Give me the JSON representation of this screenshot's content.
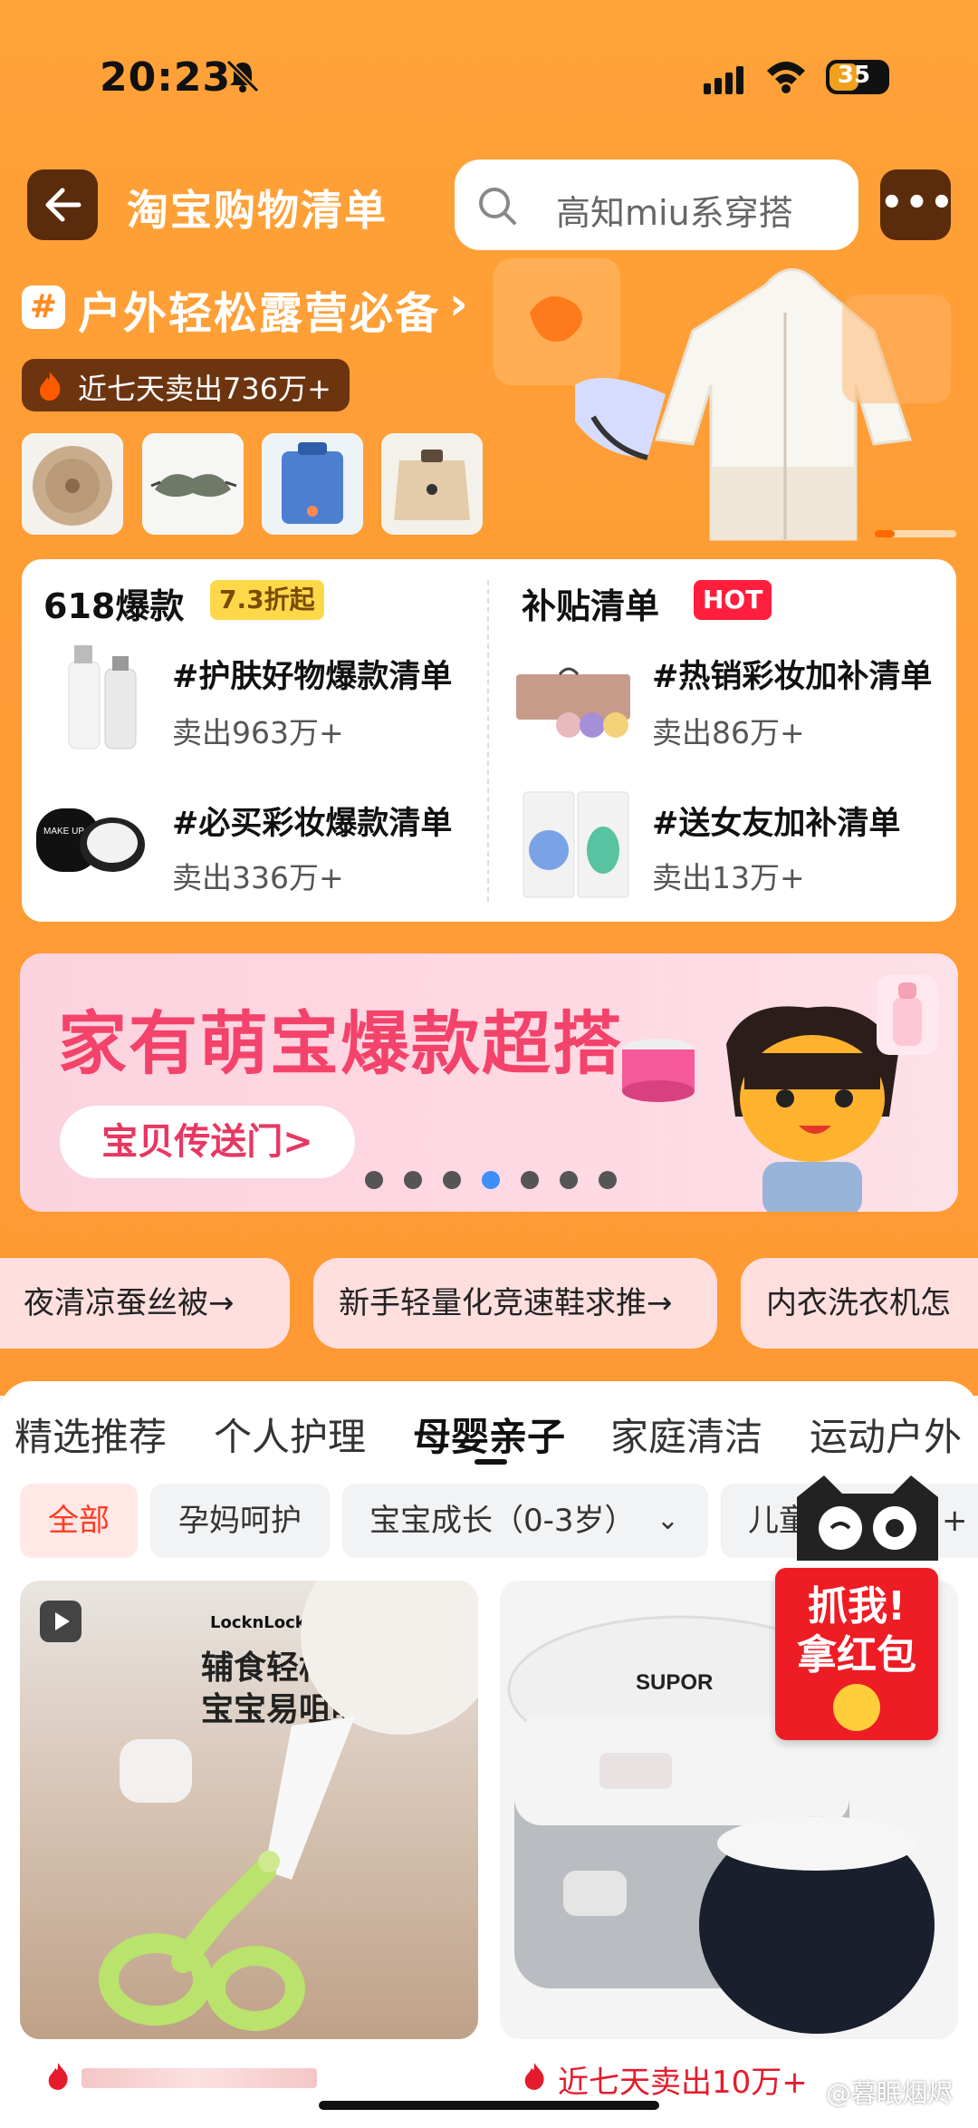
{
  "status_bar": {
    "time": "20:23",
    "battery": "35"
  },
  "header": {
    "title": "淘宝购物清单",
    "search_placeholder": "高知miu系穿搭"
  },
  "hero": {
    "title": "户外轻松露营必备",
    "hash": "#",
    "sold": "近七天卖出736万+"
  },
  "card": {
    "left": {
      "title": "618爆款",
      "tag": "7.3折起",
      "items": [
        {
          "title": "#护肤好物爆款清单",
          "sold": "卖出963万+"
        },
        {
          "title": "#必买彩妆爆款清单",
          "sold": "卖出336万+"
        }
      ]
    },
    "right": {
      "title": "补贴清单",
      "tag": "HOT",
      "items": [
        {
          "title": "#热销彩妆加补清单",
          "sold": "卖出86万+"
        },
        {
          "title": "#送女友加补清单",
          "sold": "卖出13万+"
        }
      ]
    }
  },
  "banner": {
    "title": "家有萌宝爆款超搭",
    "button": "宝贝传送门>",
    "total_pages": 7,
    "active_page": 4
  },
  "chips": [
    "夜清凉蚕丝被→",
    "新手轻量化竞速鞋求推→",
    "内衣洗衣机怎"
  ],
  "tabs": [
    "精选推荐",
    "个人护理",
    "母婴亲子",
    "家庭清洁",
    "运动户外"
  ],
  "active_tab": "母婴亲子",
  "filters": [
    "全部",
    "孕妈呵护",
    "宝宝成长（0-3岁）",
    "儿童",
    "岁+"
  ],
  "products": [
    {
      "brand": "LocknLock",
      "caption_line1": "辅食轻松剪",
      "caption_line2": "宝宝易咀嚼"
    },
    {
      "brand": "SUPOR",
      "sold": "近七天卖出10万+"
    }
  ],
  "red_envelope": {
    "line1": "抓我!",
    "line2": "拿红包"
  },
  "watermark": "@暮眠烟烬",
  "colors": {
    "orange": "#ff9d35",
    "brown": "#5b2c0c",
    "hot_red": "#ff1e3c",
    "pink_title": "#f3436b"
  }
}
